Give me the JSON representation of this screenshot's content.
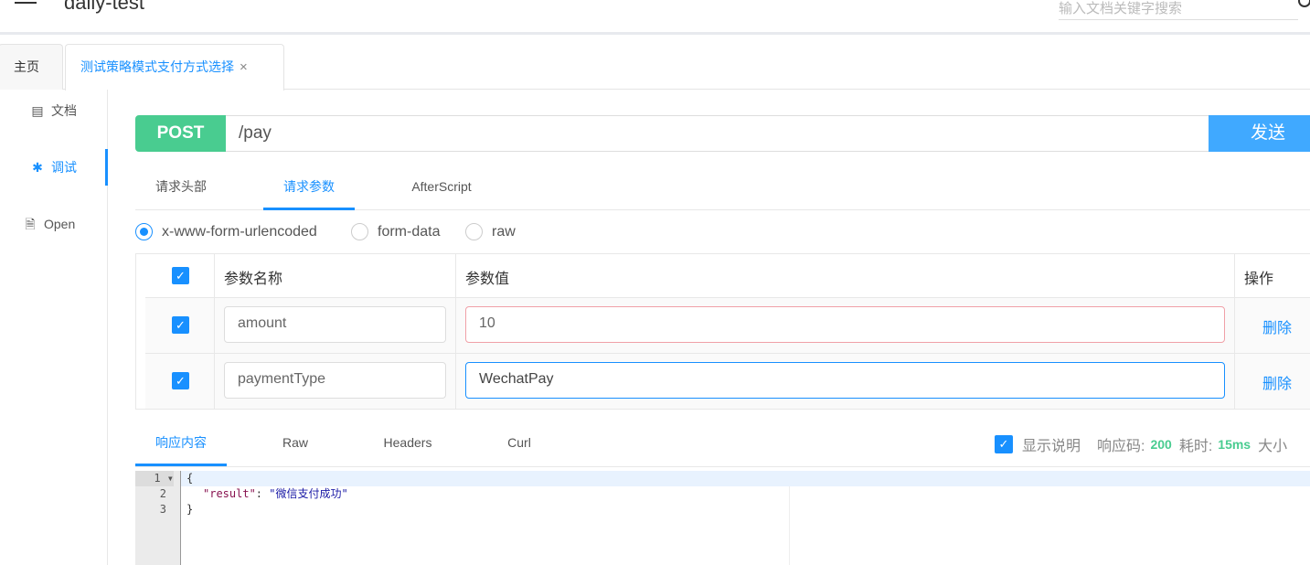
{
  "header": {
    "title": "daily-test",
    "search_placeholder": "输入文档关键字搜索"
  },
  "tabs": [
    {
      "label": "主页"
    },
    {
      "label": "测试策略模式支付方式选择",
      "close": "×"
    }
  ],
  "sidebar": {
    "items": [
      {
        "label": "文档",
        "icon": "document-icon"
      },
      {
        "label": "调试",
        "icon": "bug-icon",
        "active": true
      },
      {
        "label": "Open",
        "icon": "file-icon"
      }
    ]
  },
  "request": {
    "method": "POST",
    "url": "/pay",
    "send_label": "发送",
    "method_color": "#49cc90",
    "accent": "#1890ff"
  },
  "request_tabs": [
    {
      "label": "请求头部"
    },
    {
      "label": "请求参数",
      "active": true
    },
    {
      "label": "AfterScript"
    }
  ],
  "body_types": [
    {
      "label": "x-www-form-urlencoded",
      "selected": true
    },
    {
      "label": "form-data"
    },
    {
      "label": "raw"
    }
  ],
  "params": {
    "headers": {
      "name": "参数名称",
      "value": "参数值",
      "action": "操作"
    },
    "rows": [
      {
        "checked": true,
        "name": "amount",
        "value": "10",
        "action": "删除"
      },
      {
        "checked": true,
        "name": "paymentType",
        "value": "WechatPay",
        "action": "删除"
      }
    ]
  },
  "response_tabs": [
    {
      "label": "响应内容",
      "active": true
    },
    {
      "label": "Raw"
    },
    {
      "label": "Headers"
    },
    {
      "label": "Curl"
    }
  ],
  "response_meta": {
    "show_desc": "显示说明",
    "code_label": "响应码:",
    "code": "200",
    "time_label": "耗时:",
    "time": "15ms",
    "size_label": "大小"
  },
  "response_body": {
    "lines": [
      "1",
      "2",
      "3"
    ],
    "l1": "{",
    "key": "\"result\"",
    "colon": ": ",
    "val": "\"微信支付成功\"",
    "l3": "}"
  }
}
